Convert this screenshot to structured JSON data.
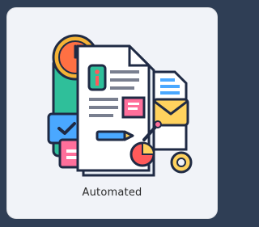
{
  "card": {
    "label": "Automated",
    "icon": "automated-document-illustration"
  },
  "colors": {
    "frame": "#2f3e55",
    "card_bg": "#f1f3f8",
    "outline": "#1f2a44",
    "clock": "#f5b335",
    "clock_face": "#ff7043",
    "doc": "#ffffff",
    "doc_shadow": "#e9eef5",
    "accent_green": "#2fbf9a",
    "accent_red": "#ff5a5a",
    "accent_blue": "#4aa8ff",
    "accent_yellow": "#ffd25e",
    "accent_pink": "#ff6f9b"
  }
}
